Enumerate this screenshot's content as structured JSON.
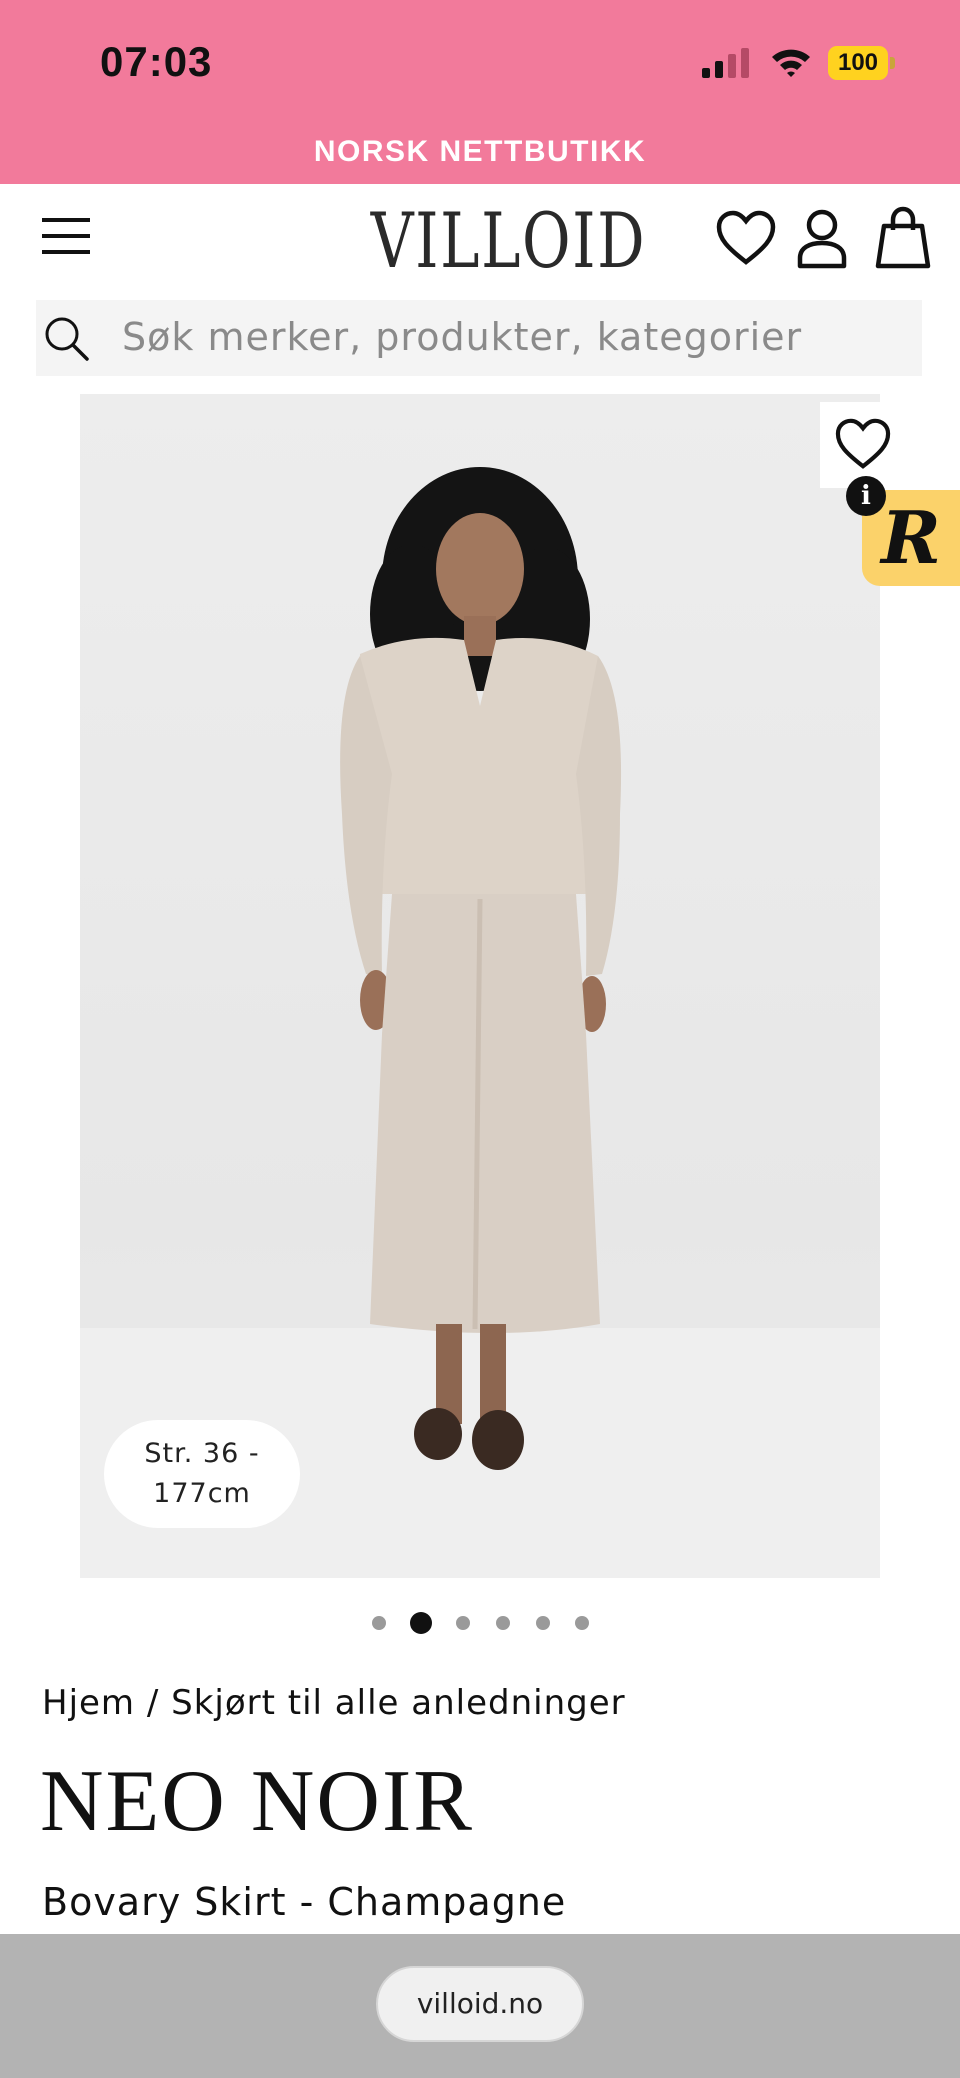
{
  "status_bar": {
    "time": "07:03",
    "battery": "100",
    "background_color": "#f27a9b",
    "icons": [
      "signal-icon",
      "wifi-icon",
      "battery-icon"
    ]
  },
  "announcement": {
    "text": "NORSK NETTBUTIKK"
  },
  "header": {
    "logo": "VILLOID",
    "icons": [
      "menu-icon",
      "heart-icon",
      "user-icon",
      "shopping-bag-icon"
    ]
  },
  "search": {
    "placeholder": "Søk merker, produkter, kategorier",
    "icon": "search-icon"
  },
  "gallery": {
    "size_info": {
      "line1": "Str. 36 -",
      "line2": "177cm"
    },
    "total_images": 6,
    "active_index": 1,
    "badge_r": "R",
    "badge_info": "i"
  },
  "product": {
    "breadcrumb": "Hjem / Skjørt til alle anledninger",
    "brand": "NEO NOIR",
    "name": "Bovary Skirt - Champagne"
  },
  "browser": {
    "url": "villoid.no"
  }
}
